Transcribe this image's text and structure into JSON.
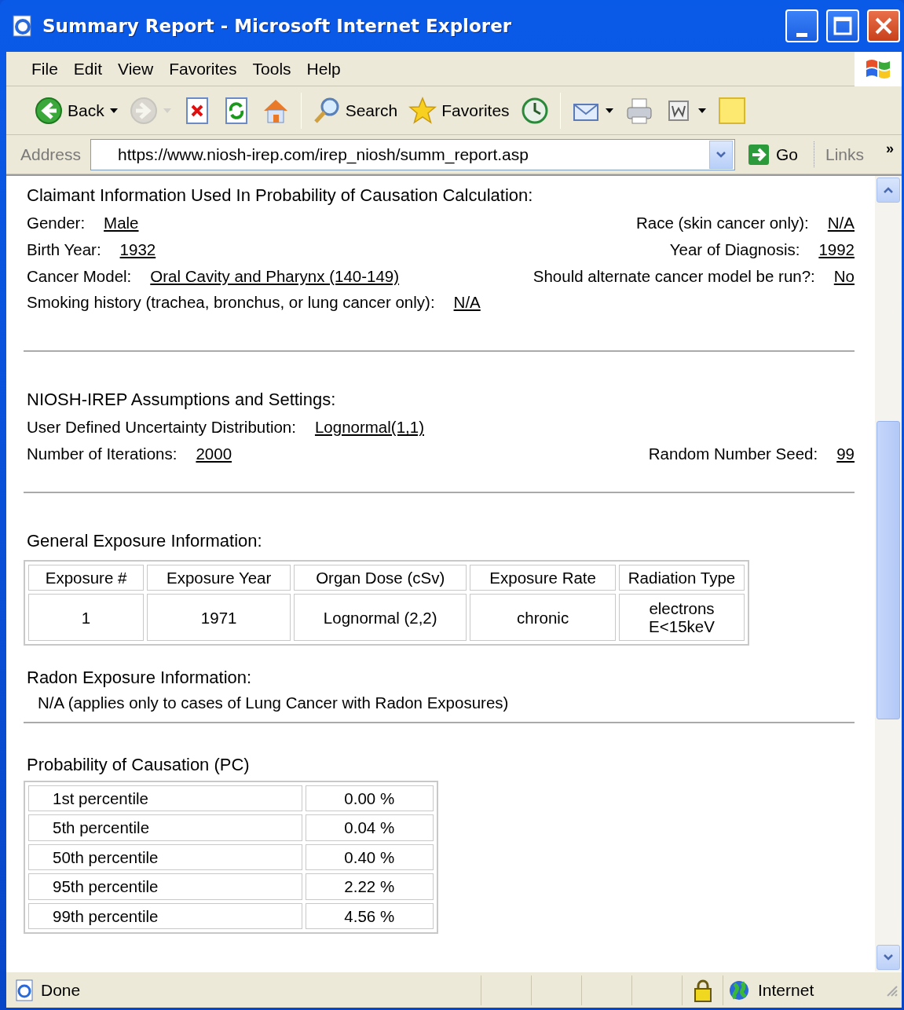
{
  "window": {
    "title": "Summary Report - Microsoft Internet Explorer"
  },
  "menu": [
    "File",
    "Edit",
    "View",
    "Favorites",
    "Tools",
    "Help"
  ],
  "toolbar": [
    {
      "kind": "back",
      "label": "Back",
      "menu": true,
      "disabled": false
    },
    {
      "kind": "forward",
      "menu": true,
      "disabled": true
    },
    {
      "kind": "stop",
      "menu": false,
      "disabled": false
    },
    {
      "kind": "refresh",
      "menu": false,
      "disabled": false
    },
    {
      "kind": "home",
      "menu": false,
      "disabled": false
    },
    {
      "kind": "separator"
    },
    {
      "kind": "search",
      "label": "Search",
      "menu": false,
      "disabled": false
    },
    {
      "kind": "favorites",
      "label": "Favorites",
      "menu": false,
      "disabled": false
    },
    {
      "kind": "history",
      "menu": false,
      "disabled": false
    },
    {
      "kind": "separator"
    },
    {
      "kind": "mail",
      "menu": true,
      "disabled": false
    },
    {
      "kind": "print",
      "menu": false,
      "disabled": false
    },
    {
      "kind": "edit",
      "menu": true,
      "disabled": false
    },
    {
      "kind": "note",
      "menu": false,
      "disabled": false
    }
  ],
  "address": {
    "label": "Address",
    "value": "https://www.niosh-irep.com/irep_niosh/summ_report.asp",
    "go": "Go",
    "links": "Links",
    "more": "»"
  },
  "claimant": {
    "title": "Claimant Information Used In Probability of Causation Calculation:",
    "rows": [
      {
        "left": {
          "label": "Gender:",
          "value": "Male"
        },
        "right": {
          "label": "Race (skin cancer only):",
          "value": "N/A"
        }
      },
      {
        "left": {
          "label": "Birth Year:",
          "value": "1932"
        },
        "right": {
          "label": "Year of Diagnosis:",
          "value": "1992"
        }
      },
      {
        "left": {
          "label": "Cancer Model:",
          "value": "Oral Cavity and Pharynx (140-149)"
        },
        "right": {
          "label": "Should alternate cancer model be run?:",
          "value": "No"
        }
      },
      {
        "left": {
          "label": "Smoking history (trachea, bronchus, or lung cancer only):",
          "value": "N/A"
        }
      }
    ]
  },
  "assumptions": {
    "title": "NIOSH-IREP Assumptions and Settings:",
    "rows": [
      {
        "left": {
          "label": "User Defined Uncertainty Distribution:",
          "value": "Lognormal(1,1)"
        }
      },
      {
        "left": {
          "label": "Number of Iterations:",
          "value": "2000"
        },
        "right": {
          "label": "Random Number Seed:",
          "value": "99"
        }
      }
    ]
  },
  "exposure": {
    "title": "General Exposure Information:",
    "columns": [
      "Exposure #",
      "Exposure Year",
      "Organ Dose (cSv)",
      "Exposure Rate",
      "Radiation Type"
    ],
    "rows": [
      [
        "1",
        "1971",
        "Lognormal (2,2)",
        "chronic",
        "electrons E<15keV"
      ]
    ]
  },
  "radon": {
    "title": "Radon Exposure Information:",
    "note": "N/A (applies only to cases of Lung Cancer with Radon Exposures)"
  },
  "pc": {
    "title": "Probability of Causation (PC)",
    "rows": [
      [
        "1st percentile",
        "0.00 %"
      ],
      [
        "5th percentile",
        "0.04 %"
      ],
      [
        "50th percentile",
        "0.40 %"
      ],
      [
        "95th percentile",
        "2.22 %"
      ],
      [
        "99th percentile",
        "4.56 %"
      ]
    ]
  },
  "status": {
    "text": "Done",
    "secure": true,
    "zone": "Internet"
  }
}
